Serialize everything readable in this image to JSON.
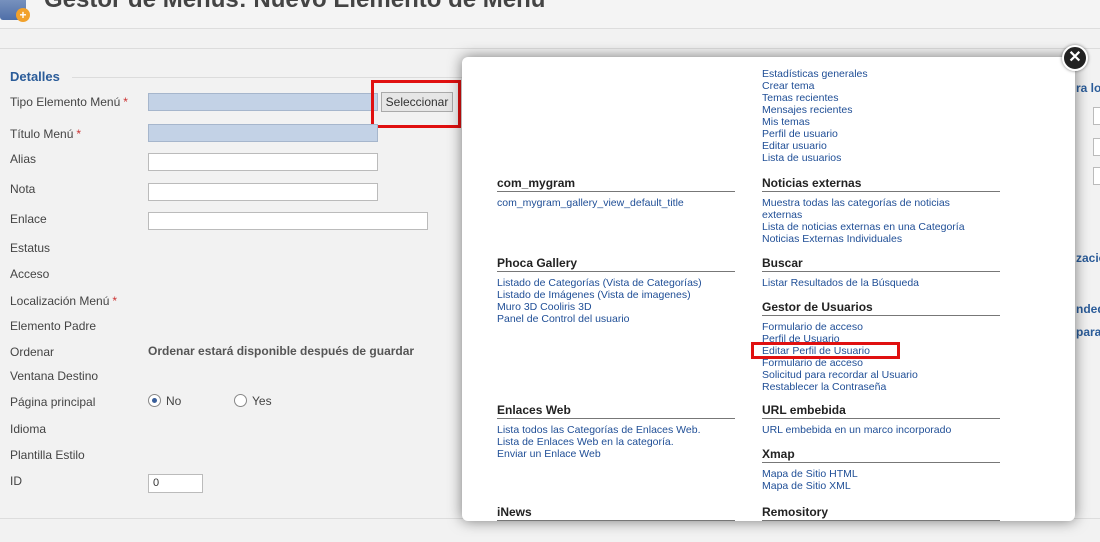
{
  "header": {
    "title": "Gestor de Menús: Nuevo Elemento de Menú"
  },
  "form": {
    "legend": "Detalles",
    "labels": {
      "tipo": "Tipo Elemento Menú",
      "titulo": "Título Menú",
      "alias": "Alias",
      "nota": "Nota",
      "enlace": "Enlace",
      "estatus": "Estatus",
      "acceso": "Acceso",
      "localizacion": "Localización Menú",
      "padre": "Elemento Padre",
      "ordenar": "Ordenar",
      "ventana": "Ventana Destino",
      "pagina": "Página principal",
      "idioma": "Idioma",
      "plantilla": "Plantilla Estilo",
      "id": "ID"
    },
    "required_mark": "*",
    "select_button": "Seleccionar",
    "order_note": "Ordenar estará disponible después de guardar",
    "home_options": {
      "no": "No",
      "yes": "Yes",
      "selected": "No"
    },
    "id_value": "0"
  },
  "right_panel": {
    "fragments": [
      "ra lo",
      "zació",
      "nded",
      "para"
    ]
  },
  "modal": {
    "top_items": [
      "Estadísticas generales",
      "Crear tema",
      "Temas recientes",
      "Mensajes recientes",
      "Mis temas",
      "Perfil de usuario",
      "Editar usuario",
      "Lista de usuarios"
    ],
    "left": [
      {
        "title": "com_mygram",
        "items": [
          "com_mygram_gallery_view_default_title"
        ]
      },
      {
        "title": "Phoca Gallery",
        "items": [
          "Listado de Categorías (Vista de Categorías)",
          "Listado de Imágenes (Vista de imagenes)",
          "Muro 3D Cooliris 3D",
          "Panel de Control del usuario"
        ]
      },
      {
        "title": "Enlaces Web",
        "items": [
          "Lista todos las Categorías de Enlaces Web.",
          "Lista de Enlaces Web en la categoría.",
          "Enviar un Enlace Web"
        ]
      },
      {
        "title": "iNews"
      }
    ],
    "right": [
      {
        "title": "Noticias externas",
        "items": [
          "Muestra todas las categorías de noticias",
          "externas",
          "Lista de noticias externas en una Categoría",
          "Noticias Externas Individuales"
        ]
      },
      {
        "title": "Buscar",
        "items": [
          "Listar Resultados de la Búsqueda"
        ]
      },
      {
        "title": "Gestor de Usuarios",
        "items": [
          "Formulario de acceso",
          "Perfil de Usuario",
          "Editar Perfil de Usuario",
          "Formulario de acceso",
          "Solicitud para recordar al Usuario",
          "Restablecer la Contraseña"
        ]
      },
      {
        "title": "URL embebida",
        "items": [
          "URL embebida en un marco incorporado"
        ]
      },
      {
        "title": "Xmap",
        "items": [
          "Mapa de Sitio HTML",
          "Mapa de Sitio XML"
        ]
      },
      {
        "title": "Remository"
      }
    ],
    "close_symbol": "✕"
  },
  "colors": {
    "link": "#1f4e96",
    "highlight": "#e01010",
    "accent": "#2b5c99"
  }
}
